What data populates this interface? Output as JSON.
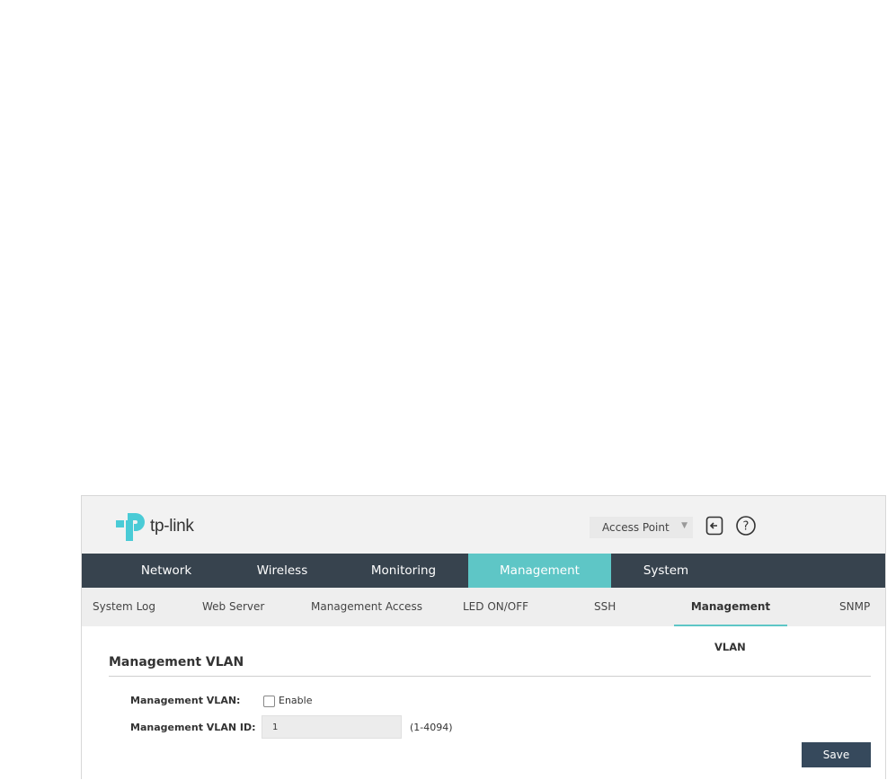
{
  "header": {
    "brand": "tp-link",
    "mode_select": {
      "selected": "Access Point"
    }
  },
  "nav": {
    "items": [
      {
        "label": "Network"
      },
      {
        "label": "Wireless"
      },
      {
        "label": "Monitoring"
      },
      {
        "label": "Management"
      },
      {
        "label": "System"
      }
    ],
    "active": "Management"
  },
  "subnav": {
    "items": [
      {
        "label": "System Log"
      },
      {
        "label": "Web Server"
      },
      {
        "label": "Management Access"
      },
      {
        "label": "LED ON/OFF"
      },
      {
        "label": "SSH"
      },
      {
        "label": "Management"
      },
      {
        "label": "SNMP"
      }
    ],
    "active_wrap": "VLAN"
  },
  "section": {
    "title": "Management VLAN",
    "vlan_label": "Management VLAN:",
    "enable_label": "Enable",
    "enable_checked": false,
    "vlan_id_label": "Management VLAN ID:",
    "vlan_id_value": "1",
    "vlan_id_range": "(1-4094)",
    "save_label": "Save"
  },
  "colors": {
    "nav_bg": "#37434e",
    "accent": "#5ec6c6",
    "save_btn": "#36495c",
    "logo": "#4acbd6"
  }
}
